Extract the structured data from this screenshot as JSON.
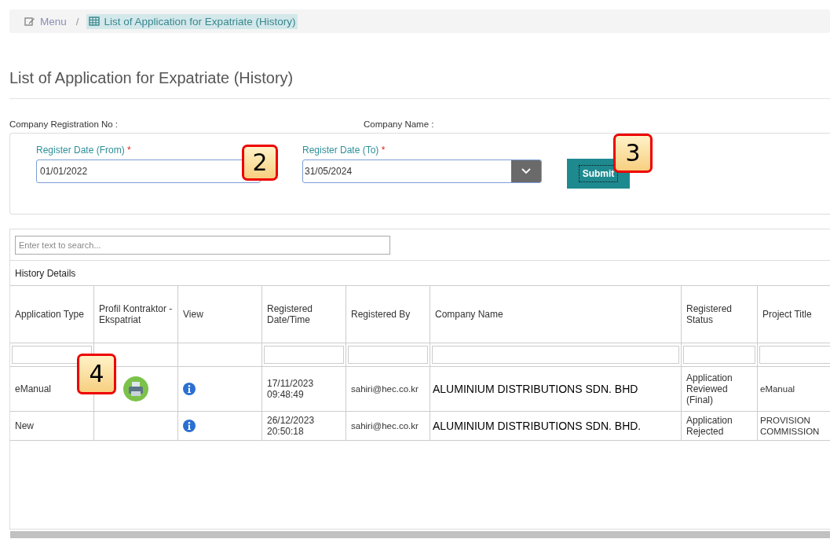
{
  "breadcrumb": {
    "separator": "/",
    "items": [
      {
        "label": "Menu",
        "selected": false
      },
      {
        "label": "List of Application for Expatriate (History)",
        "selected": true
      }
    ]
  },
  "page_title": "List of Application for Expatriate (History)",
  "info": [
    {
      "label": "Company Registration No :"
    },
    {
      "label": "Company Name :"
    }
  ],
  "filters": {
    "date_from": {
      "label": "Register Date (From)",
      "required_mark": "*",
      "value": "01/01/2022",
      "callout": "2"
    },
    "date_to": {
      "label": "Register Date (To)",
      "required_mark": "*",
      "value": "31/05/2024"
    },
    "submit": {
      "label": "Submit",
      "callout": "3"
    }
  },
  "grid": {
    "search": {
      "placeholder": "Enter text to search..."
    },
    "caption": "History Details",
    "columns": [
      {
        "label": "Application Type",
        "filter": true
      },
      {
        "label": "Profil Kontraktor - Ekspatriat",
        "filter": false
      },
      {
        "label": "View",
        "filter": false
      },
      {
        "label": "Registered Date/Time",
        "filter": true
      },
      {
        "label": "Registered By",
        "filter": true
      },
      {
        "label": "Company Name",
        "filter": true
      },
      {
        "label": "Registered Status",
        "filter": true
      },
      {
        "label": "Project Title",
        "filter": true
      }
    ],
    "rows": [
      {
        "application_type": "eManual",
        "has_profile": true,
        "profile_callout": "4",
        "registered": "17/11/2023 09:48:49",
        "registered_by": "sahiri@hec.co.kr",
        "company_name": "ALUMINIUM DISTRIBUTIONS SDN. BHD",
        "status": "Application Reviewed (Final)",
        "project_title": "eManual"
      },
      {
        "application_type": "New",
        "has_profile": false,
        "registered": "26/12/2023 20:50:18",
        "registered_by": "sahiri@hec.co.kr",
        "company_name": "ALUMINIUM DISTRIBUTIONS SDN. BHD.",
        "status": "Application Rejected",
        "project_title": "PROVISION COMMISSION"
      }
    ]
  }
}
